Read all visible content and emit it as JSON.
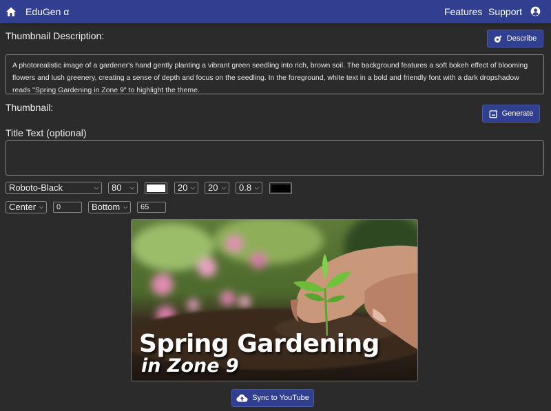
{
  "navbar": {
    "brand": "EduGen α",
    "features": "Features",
    "support": "Support",
    "color": "#303f8f"
  },
  "description": {
    "label": "Thumbnail Description:",
    "button": "Describe",
    "text": "A photorealistic image of a gardener's hand gently planting a vibrant green seedling into rich, brown soil. The background features a soft bokeh effect of blooming flowers and lush greenery, creating a sense of depth and focus on the seedling. In the foreground, white text in a bold and friendly font with a dark dropshadow reads \"Spring Gardening in Zone 9\" to highlight the theme."
  },
  "thumbnail": {
    "label": "Thumbnail:",
    "button": "Generate",
    "title_label": "Title Text (optional)",
    "title_value": "",
    "image_text_line1": "Spring Gardening",
    "image_text_line2": "in Zone 9"
  },
  "text_options": {
    "font": "Roboto-Black",
    "font_size": "80",
    "text_color": "#ffffff",
    "shadow_x": "20",
    "shadow_y": "20",
    "shadow_opacity": "0.8",
    "shadow_color": "#000000",
    "h_align": "Center",
    "h_offset": "0",
    "v_align": "Bottom",
    "v_offset": "65"
  },
  "sync_button": "Sync to YouTube"
}
